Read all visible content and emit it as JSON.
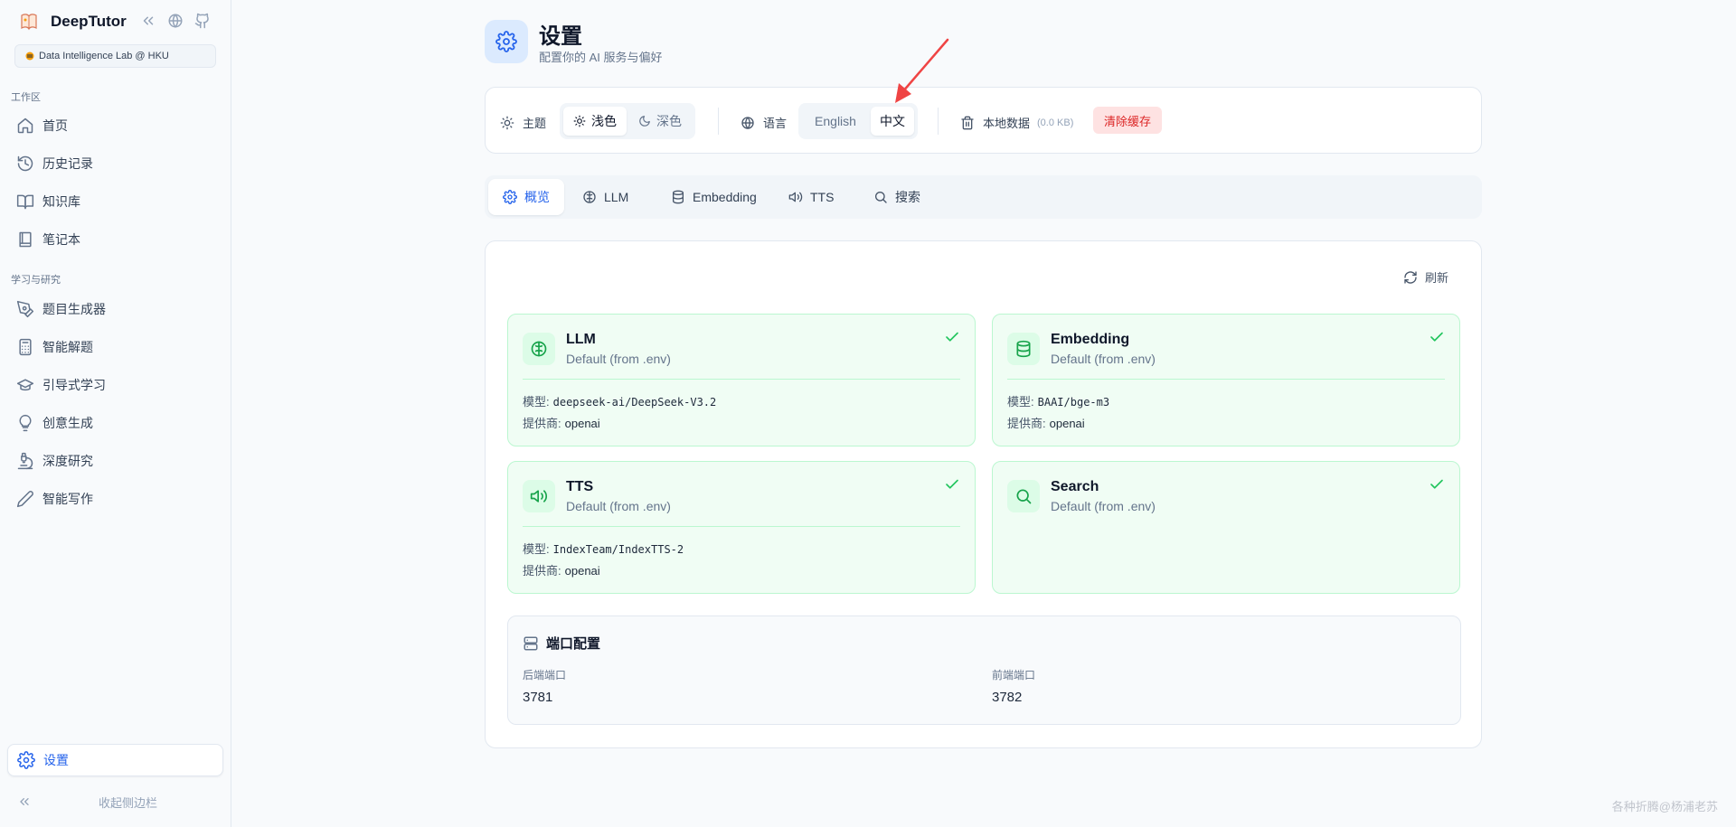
{
  "app": {
    "name": "DeepTutor",
    "lab_badge": "Data Intelligence Lab @ HKU"
  },
  "sidebar": {
    "section_workspace": "工作区",
    "workspace_items": [
      {
        "label": "首页",
        "icon": "home-icon"
      },
      {
        "label": "历史记录",
        "icon": "history-icon"
      },
      {
        "label": "知识库",
        "icon": "book-open-icon"
      },
      {
        "label": "笔记本",
        "icon": "notebook-icon"
      }
    ],
    "section_learning": "学习与研究",
    "learning_items": [
      {
        "label": "题目生成器",
        "icon": "pen-tool-icon"
      },
      {
        "label": "智能解题",
        "icon": "calculator-icon"
      },
      {
        "label": "引导式学习",
        "icon": "graduation-cap-icon"
      },
      {
        "label": "创意生成",
        "icon": "lightbulb-icon"
      },
      {
        "label": "深度研究",
        "icon": "microscope-icon"
      },
      {
        "label": "智能写作",
        "icon": "pencil-icon"
      }
    ],
    "settings_label": "设置",
    "collapse_label": "收起侧边栏"
  },
  "header": {
    "title": "设置",
    "subtitle": "配置你的 AI 服务与偏好"
  },
  "settings_bar": {
    "theme_label": "主题",
    "theme_light": "浅色",
    "theme_dark": "深色",
    "theme_selected": "浅色",
    "language_label": "语言",
    "lang_en": "English",
    "lang_zh": "中文",
    "language_selected": "中文",
    "local_data_label": "本地数据",
    "cache_size": "(0.0 KB)",
    "clear_cache": "清除缓存"
  },
  "tabs": [
    {
      "label": "概览",
      "icon": "gear-icon",
      "active": true
    },
    {
      "label": "LLM",
      "icon": "brain-icon",
      "active": false
    },
    {
      "label": "Embedding",
      "icon": "database-icon",
      "active": false
    },
    {
      "label": "TTS",
      "icon": "speaker-icon",
      "active": false
    },
    {
      "label": "搜索",
      "icon": "search-icon",
      "active": false
    }
  ],
  "overview": {
    "refresh_label": "刷新",
    "model_label": "模型:",
    "provider_label": "提供商:",
    "services": [
      {
        "name": "LLM",
        "source": "Default (from .env)",
        "model": "deepseek-ai/DeepSeek-V3.2",
        "provider": "openai",
        "icon": "brain-icon",
        "status": "ok"
      },
      {
        "name": "Embedding",
        "source": "Default (from .env)",
        "model": "BAAI/bge-m3",
        "provider": "openai",
        "icon": "database-icon",
        "status": "ok"
      },
      {
        "name": "TTS",
        "source": "Default (from .env)",
        "model": "IndexTeam/IndexTTS-2",
        "provider": "openai",
        "icon": "speaker-icon",
        "status": "ok"
      },
      {
        "name": "Search",
        "source": "Default (from .env)",
        "icon": "search-icon",
        "status": "ok"
      }
    ],
    "ports": {
      "title": "端口配置",
      "backend_label": "后端端口",
      "backend_value": "3781",
      "frontend_label": "前端端口",
      "frontend_value": "3782"
    }
  },
  "watermark": "各种折腾@杨浦老苏",
  "colors": {
    "accent": "#2563eb",
    "success": "#22c55e",
    "success_bg": "#f0fdf4",
    "danger": "#dc2626",
    "danger_bg": "#fee2e2",
    "annotation_arrow": "#ef4444"
  }
}
